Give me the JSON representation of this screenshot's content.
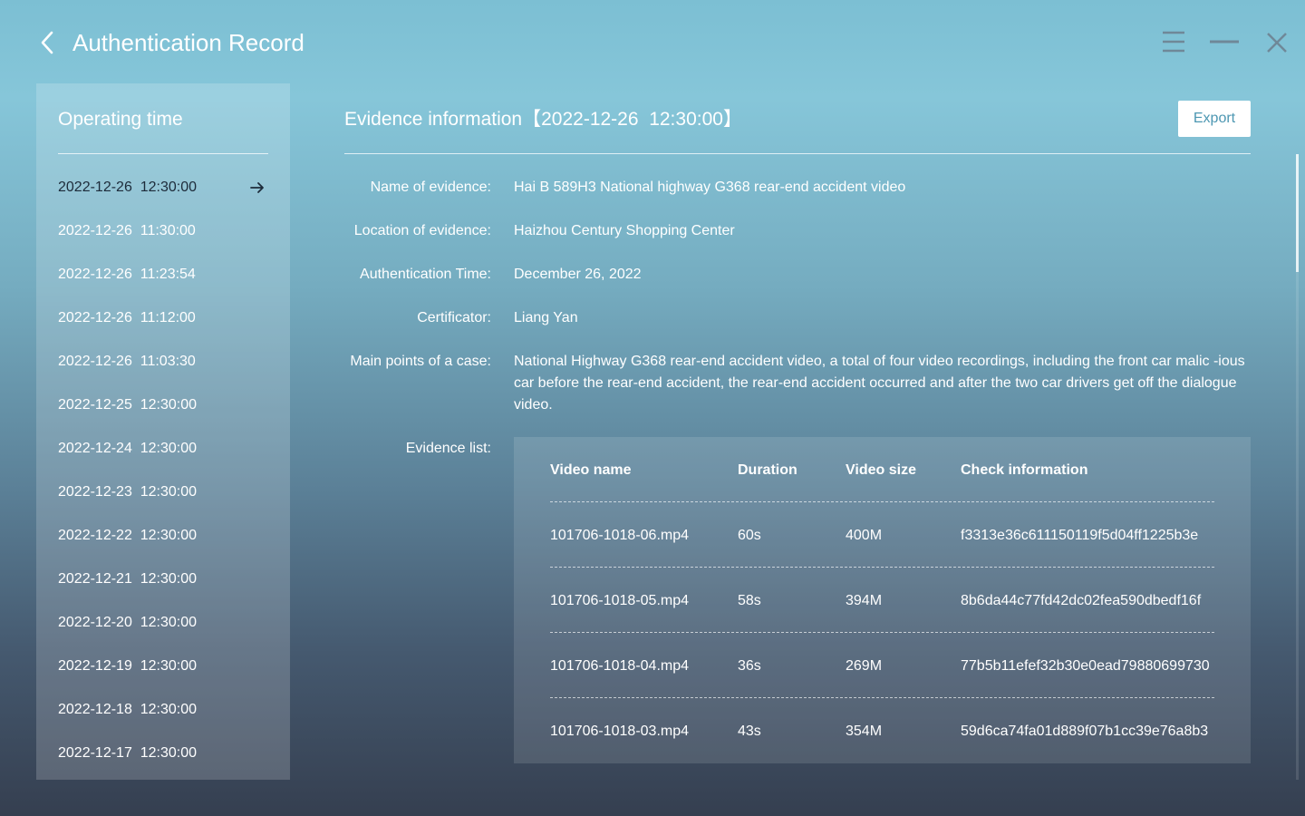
{
  "header": {
    "title": "Authentication Record",
    "back_icon": "chevron-left-icon",
    "menu_icon": "menu-icon",
    "minimize_icon": "minimize-icon",
    "close_icon": "close-icon"
  },
  "sidebar": {
    "title": "Operating time",
    "active_index": 0,
    "items": [
      {
        "label": "2022-12-26  12:30:00"
      },
      {
        "label": "2022-12-26  11:30:00"
      },
      {
        "label": "2022-12-26  11:23:54"
      },
      {
        "label": "2022-12-26  11:12:00"
      },
      {
        "label": "2022-12-26  11:03:30"
      },
      {
        "label": "2022-12-25  12:30:00"
      },
      {
        "label": "2022-12-24  12:30:00"
      },
      {
        "label": "2022-12-23  12:30:00"
      },
      {
        "label": "2022-12-22  12:30:00"
      },
      {
        "label": "2022-12-21  12:30:00"
      },
      {
        "label": "2022-12-20  12:30:00"
      },
      {
        "label": "2022-12-19  12:30:00"
      },
      {
        "label": "2022-12-18  12:30:00"
      },
      {
        "label": "2022-12-17  12:30:00"
      }
    ]
  },
  "main": {
    "title": "Evidence information【2022-12-26  12:30:00】",
    "export_label": "Export",
    "fields": {
      "name": {
        "label": "Name of evidence:",
        "value": "Hai B 589H3 National highway G368 rear-end accident video"
      },
      "location": {
        "label": "Location of evidence:",
        "value": "Haizhou Century Shopping Center"
      },
      "auth_time": {
        "label": "Authentication Time:",
        "value": "December 26, 2022"
      },
      "certificator": {
        "label": "Certificator:",
        "value": "Liang Yan"
      },
      "main_points": {
        "label": "Main points of a case:",
        "value": "National Highway G368 rear-end accident video, a total of four video recordings, including the front car malic -ious car before the rear-end accident, the rear-end accident occurred and after the two car drivers get off the dialogue video."
      },
      "evidence_list": {
        "label": "Evidence list:"
      }
    },
    "table": {
      "columns": [
        "Video name",
        "Duration",
        "Video size",
        "Check information"
      ],
      "rows": [
        [
          "101706-1018-06.mp4",
          "60s",
          "400M",
          "f3313e36c611150119f5d04ff1225b3e"
        ],
        [
          "101706-1018-05.mp4",
          "58s",
          "394M",
          "8b6da44c77fd42dc02fea590dbedf16f"
        ],
        [
          "101706-1018-04.mp4",
          "36s",
          "269M",
          "77b5b11efef32b30e0ead79880699730"
        ],
        [
          "101706-1018-03.mp4",
          "43s",
          "354M",
          "59d6ca74fa01d889f07b1cc39e76a8b3"
        ]
      ]
    }
  },
  "colors": {
    "export_text": "#4d97b2",
    "active_item_text": "#1d2b3a"
  }
}
